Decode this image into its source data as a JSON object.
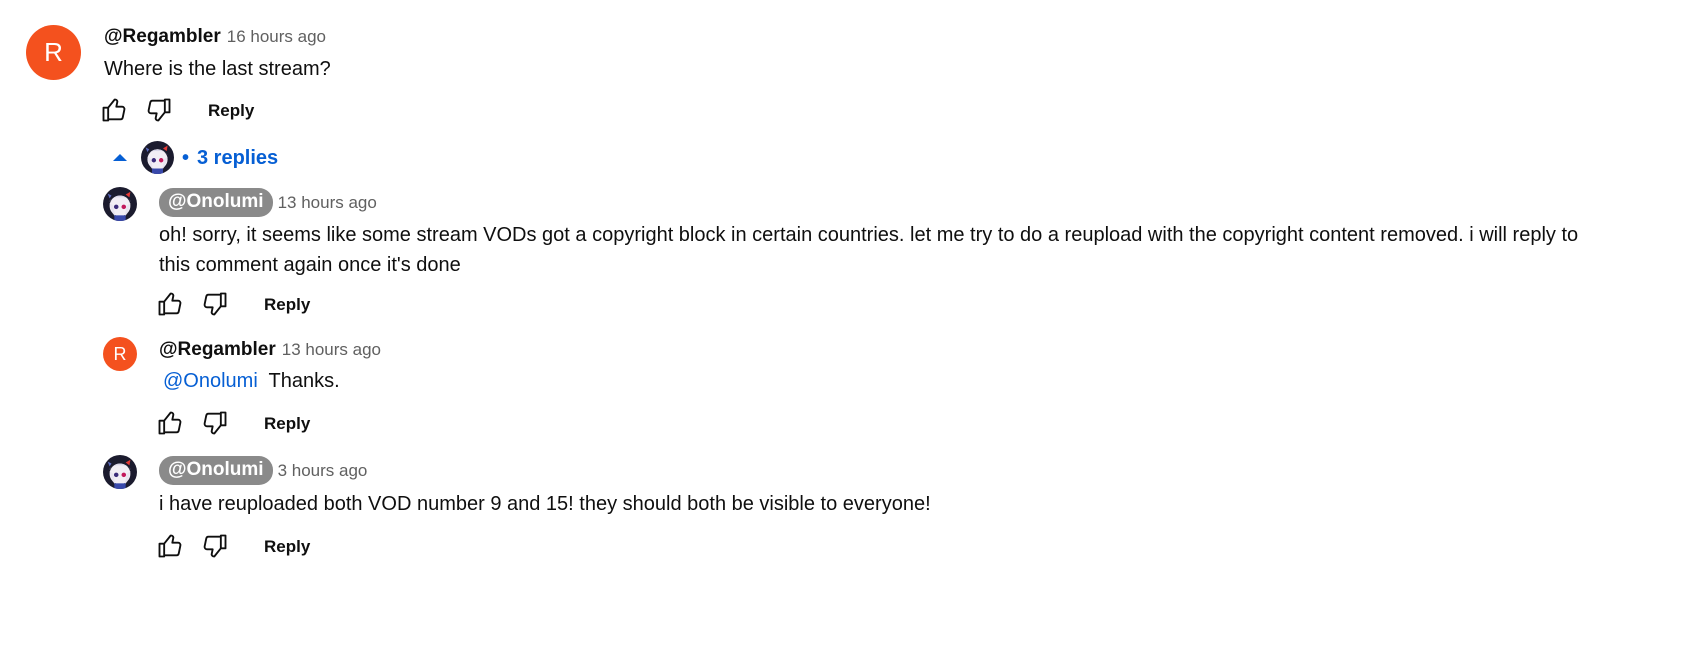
{
  "colors": {
    "avatar_orange": "#f4511e",
    "link_blue": "#065fd4",
    "chip_gray": "#8a8a8a"
  },
  "top_comment": {
    "avatar_letter": "R",
    "author": "@Regambler",
    "time": "16 hours ago",
    "text": "Where is the last stream?",
    "reply_label": "Reply"
  },
  "replies_toggle": {
    "bullet": "•",
    "label": "3 replies"
  },
  "replies": [
    {
      "author": "@Onolumi",
      "time": "13 hours ago",
      "text_line1": "oh! sorry, it seems like some stream VODs got a copyright block in certain countries. let me try to do a reupload with the copyright content removed. i will reply to",
      "text_line2": "this comment again once it's done",
      "reply_label": "Reply"
    },
    {
      "avatar_letter": "R",
      "author": "@Regambler",
      "time": "13 hours ago",
      "mention": "@Onolumi",
      "text": "Thanks.",
      "reply_label": "Reply"
    },
    {
      "author": "@Onolumi",
      "time": "3 hours ago",
      "text": "i have reuploaded both VOD number 9 and 15! they should both be visible to everyone!",
      "reply_label": "Reply"
    }
  ]
}
